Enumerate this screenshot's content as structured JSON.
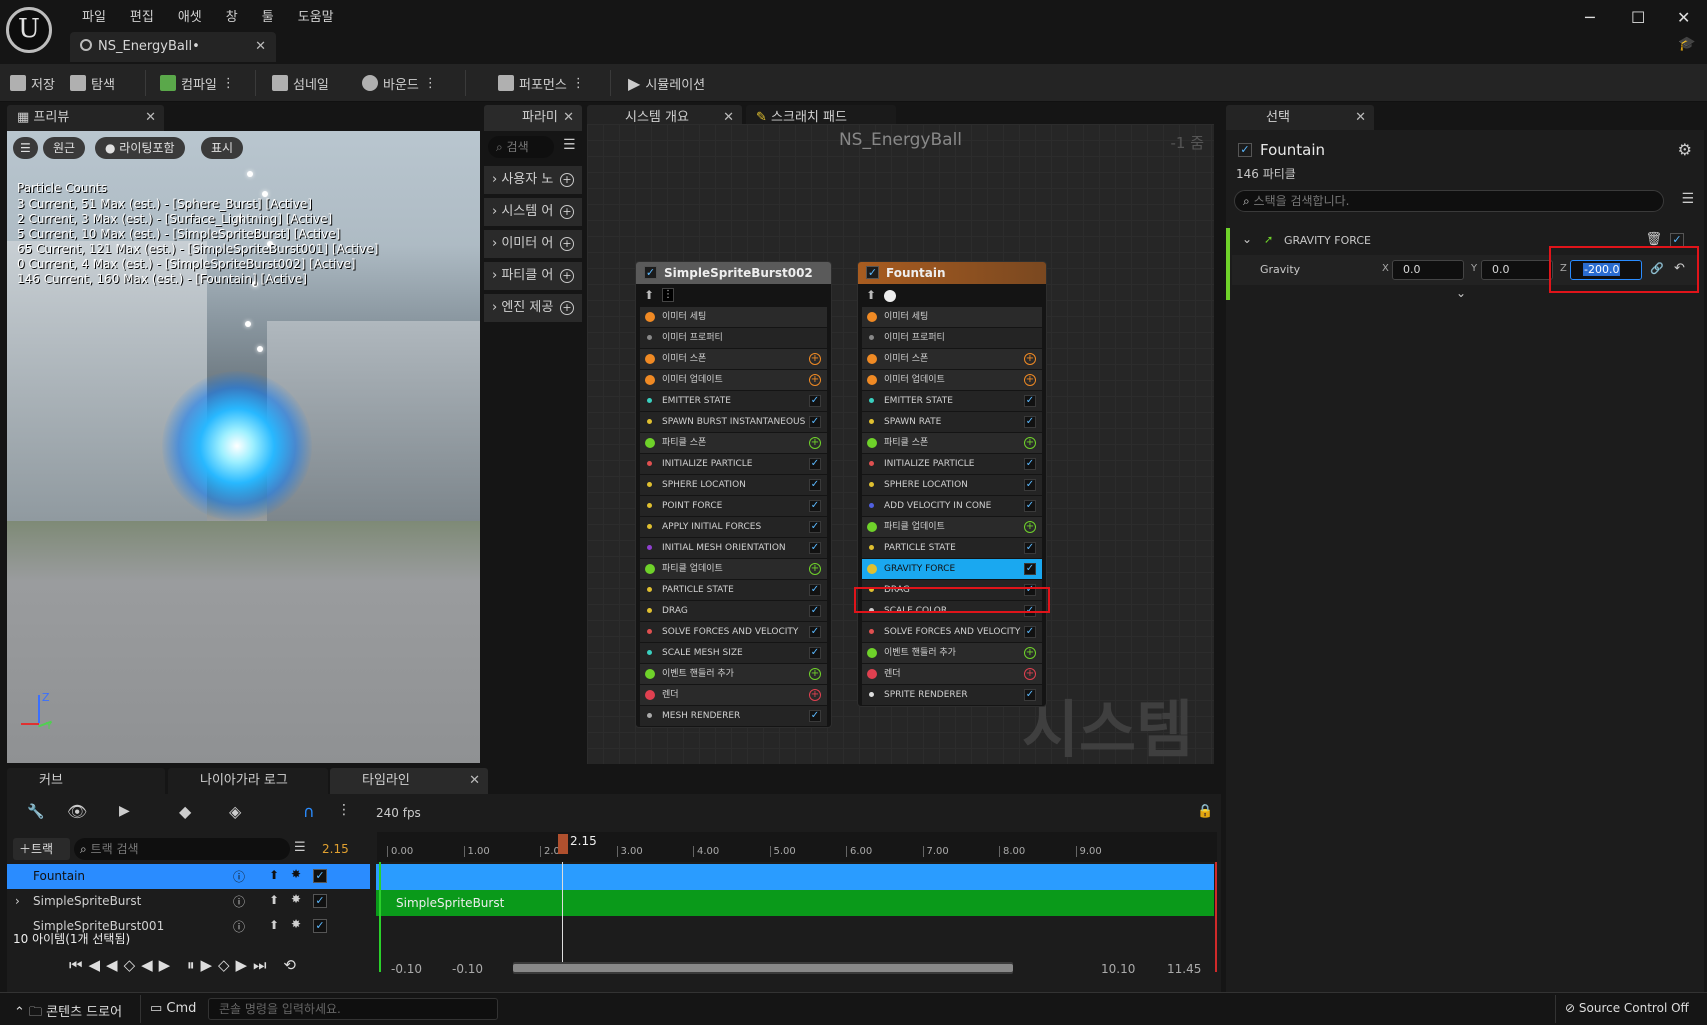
{
  "app": {
    "menu": [
      "파일",
      "편집",
      "애셋",
      "창",
      "툴",
      "도움말"
    ],
    "doc_tab": "NS_EnergyBall•",
    "window_controls": {
      "minimize": "─",
      "maximize": "☐",
      "close": "✕"
    }
  },
  "toolbar": {
    "save": "저장",
    "browse": "탐색",
    "compile": "컴파일",
    "thumbnail": "섬네일",
    "bounds": "바운드",
    "performance": "퍼포먼스",
    "simulation": "시뮬레이션"
  },
  "preview": {
    "tab": "프리뷰",
    "btn_perspective": "원근",
    "btn_lighting": "라이팅포함",
    "btn_show": "표시",
    "stats_title": "Particle Counts",
    "stats": [
      "3 Current, 51 Max (est.) - [Sphere_Burst] [Active]",
      "2 Current, 3 Max (est.) - [Surface_Lightning] [Active]",
      "5 Current, 10 Max (est.) - [SimpleSpriteBurst] [Active]",
      "65 Current, 121 Max (est.) - [SimpleSpriteBurst001] [Active]",
      "0 Current, 4 Max (est.) - [SimpleSpriteBurst002] [Active]",
      "146 Current, 160 Max (est.) - [Fountain] [Active]"
    ],
    "axis_z": "Z",
    "axis_y": "Y"
  },
  "params": {
    "tab": "파라미",
    "search_placeholder": "검색",
    "items": [
      "사용자 노",
      "시스템 어",
      "이미터 어",
      "파티클 어",
      "엔진 제공"
    ]
  },
  "graph": {
    "tab_overview": "시스템 개요",
    "tab_scratch": "스크래치 패드",
    "title": "NS_EnergyBall",
    "zoom": "-1 줌",
    "watermark": "시스템",
    "node1": {
      "title": "SimpleSpriteBurst002",
      "rows": [
        {
          "label": "이미터 세팅",
          "type": "grp",
          "color": "#f08a24",
          "cb": "none"
        },
        {
          "label": "이미터 프로퍼티",
          "type": "row",
          "color": "#888888",
          "cb": "none"
        },
        {
          "label": "이미터 스폰",
          "type": "grp",
          "color": "#f08a24",
          "cb": "plus",
          "pc": "#f08a24"
        },
        {
          "label": "이미터 업데이트",
          "type": "grp",
          "color": "#f08a24",
          "cb": "plus",
          "pc": "#f08a24"
        },
        {
          "label": "EMITTER STATE",
          "type": "row",
          "color": "#3ad0c0",
          "cb": "check"
        },
        {
          "label": "SPAWN BURST INSTANTANEOUS",
          "type": "row",
          "color": "#e0c030",
          "cb": "check"
        },
        {
          "label": "파티클 스폰",
          "type": "grp",
          "color": "#6fd22a",
          "cb": "plus",
          "pc": "#6fd22a"
        },
        {
          "label": "INITIALIZE PARTICLE",
          "type": "row",
          "color": "#e05050",
          "cb": "check"
        },
        {
          "label": "SPHERE LOCATION",
          "type": "row",
          "color": "#e0c030",
          "cb": "check"
        },
        {
          "label": "POINT FORCE",
          "type": "row",
          "color": "#e0c030",
          "cb": "check"
        },
        {
          "label": "APPLY INITIAL FORCES",
          "type": "row",
          "color": "#e0c030",
          "cb": "check"
        },
        {
          "label": "INITIAL MESH ORIENTATION",
          "type": "row",
          "color": "#9040d0",
          "cb": "check"
        },
        {
          "label": "파티클 업데이트",
          "type": "grp",
          "color": "#6fd22a",
          "cb": "plus",
          "pc": "#6fd22a"
        },
        {
          "label": "PARTICLE STATE",
          "type": "row",
          "color": "#e0c030",
          "cb": "check"
        },
        {
          "label": "DRAG",
          "type": "row",
          "color": "#e0c030",
          "cb": "check"
        },
        {
          "label": "SOLVE FORCES AND VELOCITY",
          "type": "row",
          "color": "#e05050",
          "cb": "check"
        },
        {
          "label": "SCALE MESH SIZE",
          "type": "row",
          "color": "#3ad0c0",
          "cb": "check"
        },
        {
          "label": "이벤트 핸들러 추가",
          "type": "grp",
          "color": "#6fd22a",
          "cb": "plus",
          "pc": "#6fd22a"
        },
        {
          "label": "렌더",
          "type": "grp",
          "color": "#e04050",
          "cb": "plus",
          "pc": "#e04050"
        },
        {
          "label": "MESH RENDERER",
          "type": "row",
          "color": "#aaaaaa",
          "cb": "check"
        }
      ]
    },
    "node2": {
      "title": "Fountain",
      "rows": [
        {
          "label": "이미터 세팅",
          "type": "grp",
          "color": "#f08a24",
          "cb": "none"
        },
        {
          "label": "이미터 프로퍼티",
          "type": "row",
          "color": "#888888",
          "cb": "none"
        },
        {
          "label": "이미터 스폰",
          "type": "grp",
          "color": "#f08a24",
          "cb": "plus",
          "pc": "#f08a24"
        },
        {
          "label": "이미터 업데이트",
          "type": "grp",
          "color": "#f08a24",
          "cb": "plus",
          "pc": "#f08a24"
        },
        {
          "label": "EMITTER STATE",
          "type": "row",
          "color": "#3ad0c0",
          "cb": "check"
        },
        {
          "label": "SPAWN RATE",
          "type": "row",
          "color": "#e0c030",
          "cb": "check"
        },
        {
          "label": "파티클 스폰",
          "type": "grp",
          "color": "#6fd22a",
          "cb": "plus",
          "pc": "#6fd22a"
        },
        {
          "label": "INITIALIZE PARTICLE",
          "type": "row",
          "color": "#e05050",
          "cb": "check"
        },
        {
          "label": "SPHERE LOCATION",
          "type": "row",
          "color": "#e0c030",
          "cb": "check"
        },
        {
          "label": "ADD VELOCITY IN CONE",
          "type": "row",
          "color": "#5060e0",
          "cb": "check"
        },
        {
          "label": "파티클 업데이트",
          "type": "grp",
          "color": "#6fd22a",
          "cb": "plus",
          "pc": "#6fd22a"
        },
        {
          "label": "PARTICLE STATE",
          "type": "row",
          "color": "#e0c030",
          "cb": "check"
        },
        {
          "label": "GRAVITY FORCE",
          "type": "sel",
          "color": "#e0c030",
          "cb": "check"
        },
        {
          "label": "DRAG",
          "type": "row",
          "color": "#e0c030",
          "cb": "check"
        },
        {
          "label": "SCALE COLOR",
          "type": "row",
          "color": "#cccccc",
          "cb": "check"
        },
        {
          "label": "SOLVE FORCES AND VELOCITY",
          "type": "row",
          "color": "#e05050",
          "cb": "check"
        },
        {
          "label": "이벤트 핸들러 추가",
          "type": "grp",
          "color": "#6fd22a",
          "cb": "plus",
          "pc": "#6fd22a"
        },
        {
          "label": "렌더",
          "type": "grp",
          "color": "#e04050",
          "cb": "plus",
          "pc": "#e04050"
        },
        {
          "label": "SPRITE RENDERER",
          "type": "row",
          "color": "#dddddd",
          "cb": "check"
        }
      ]
    }
  },
  "details": {
    "tab": "선택",
    "emitter": "Fountain",
    "particle_count": "146 파티클",
    "search_placeholder": "스택을 검색합니다.",
    "section": "GRAVITY FORCE",
    "prop": "Gravity",
    "x_label": "X",
    "x_value": "0.0",
    "y_label": "Y",
    "y_value": "0.0",
    "z_label": "Z",
    "z_value": "-200.0"
  },
  "timeline": {
    "tab_curve": "커브",
    "tab_log": "나이아가라 로그",
    "tab_timeline": "타임라인",
    "fps": "240 fps",
    "add_track": "트랙",
    "search_placeholder": "트랙 검색",
    "current_time_left": "2.15",
    "playhead": "2.15",
    "ticks": [
      "0.00",
      "1.00",
      "2.00",
      "3.00",
      "4.00",
      "5.00",
      "6.00",
      "7.00",
      "8.00",
      "9.00"
    ],
    "tracks": [
      {
        "name": "Fountain",
        "selected": true
      },
      {
        "name": "SimpleSpriteBurst",
        "selected": false
      },
      {
        "name": "SimpleSpriteBurst001",
        "selected": false
      }
    ],
    "item_count": "10 아이템(1개 선택됨)",
    "bar_label": "SimpleSpriteBurst",
    "range_start": "-0.10",
    "range_start2": "-0.10",
    "range_end": "10.10",
    "range_end2": "11.45"
  },
  "status": {
    "content_drawer": "콘텐츠 드로어",
    "cmd": "Cmd",
    "cmd_placeholder": "콘솔 명령을 입력하세요.",
    "source_control": "Source Control Off"
  }
}
